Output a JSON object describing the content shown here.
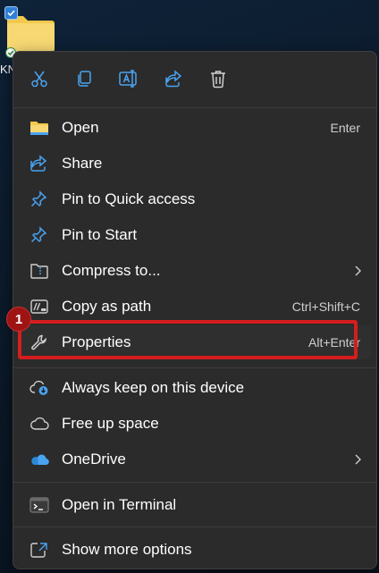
{
  "desktop": {
    "folder_label": "KN",
    "folder_color": "#f2c94c"
  },
  "toolbar": {
    "icons": [
      "cut-icon",
      "copy-icon",
      "rename-icon",
      "share-icon",
      "delete-icon"
    ]
  },
  "menu": {
    "items": [
      {
        "label": "Open",
        "shortcut": "Enter",
        "icon": "folder-icon"
      },
      {
        "label": "Share",
        "shortcut": "",
        "icon": "share-icon"
      },
      {
        "label": "Pin to Quick access",
        "shortcut": "",
        "icon": "pin-icon"
      },
      {
        "label": "Pin to Start",
        "shortcut": "",
        "icon": "pin-icon"
      },
      {
        "label": "Compress to...",
        "shortcut": "",
        "icon": "zip-folder-icon",
        "submenu": true
      },
      {
        "label": "Copy as path",
        "shortcut": "Ctrl+Shift+C",
        "icon": "copy-path-icon"
      },
      {
        "label": "Properties",
        "shortcut": "Alt+Enter",
        "icon": "wrench-icon"
      },
      {
        "label": "Always keep on this device",
        "shortcut": "",
        "icon": "cloud-download-icon"
      },
      {
        "label": "Free up space",
        "shortcut": "",
        "icon": "cloud-icon"
      },
      {
        "label": "OneDrive",
        "shortcut": "",
        "icon": "onedrive-icon",
        "submenu": true
      },
      {
        "label": "Open in Terminal",
        "shortcut": "",
        "icon": "terminal-icon"
      },
      {
        "label": "Show more options",
        "shortcut": "",
        "icon": "show-more-icon"
      }
    ]
  },
  "annotation": {
    "step_number": "1",
    "highlight_color": "#d41e1e"
  },
  "colors": {
    "accent": "#4aa3f0",
    "menu_bg": "#2b2b2b",
    "text": "#ffffff"
  }
}
